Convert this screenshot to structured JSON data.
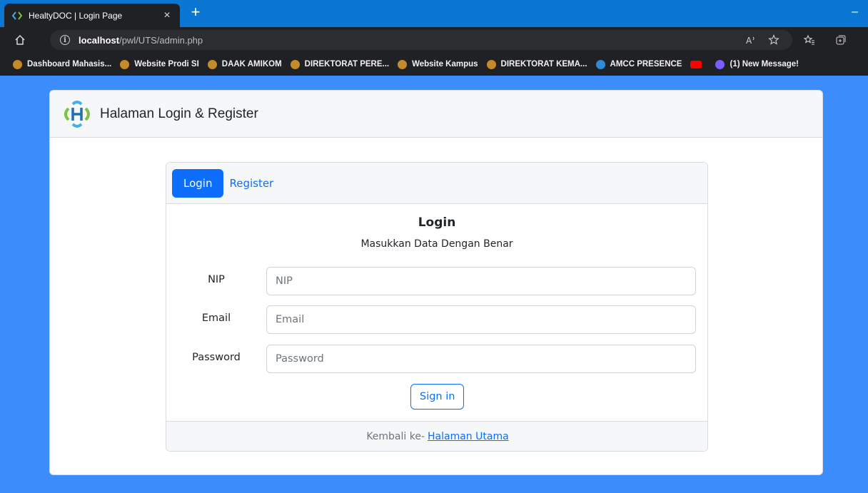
{
  "browser": {
    "tab_title": "HealtyDOC | Login Page",
    "tab_close": "×",
    "new_tab": "+",
    "minimize": "–",
    "url_host": "localhost",
    "url_path": "/pwl/UTS/admin.php"
  },
  "bookmarks": [
    {
      "label": "Dashboard Mahasis...",
      "icon_color": "#c58a2a"
    },
    {
      "label": "Website Prodi SI",
      "icon_color": "#c58a2a"
    },
    {
      "label": "DAAK AMIKOM",
      "icon_color": "#c58a2a"
    },
    {
      "label": "DIREKTORAT PERE...",
      "icon_color": "#c58a2a"
    },
    {
      "label": "Website Kampus",
      "icon_color": "#c58a2a"
    },
    {
      "label": "DIREKTORAT KEMA...",
      "icon_color": "#c58a2a"
    },
    {
      "label": "AMCC PRESENCE",
      "icon_color": "#2f8bd6"
    },
    {
      "label": "",
      "icon_color": "#ff0000"
    },
    {
      "label": "(1) New Message!",
      "icon_color": "#7a5cff"
    }
  ],
  "page": {
    "title": "Halaman Login & Register"
  },
  "tabs": {
    "login": "Login",
    "register": "Register"
  },
  "login": {
    "heading": "Login",
    "subtitle": "Masukkan Data Dengan Benar",
    "fields": [
      {
        "label": "NIP",
        "placeholder": "NIP"
      },
      {
        "label": "Email",
        "placeholder": "Email"
      },
      {
        "label": "Password",
        "placeholder": "Password"
      }
    ],
    "submit": "Sign in",
    "footer_text": "Kembali ke-",
    "footer_link": "Halaman Utama"
  },
  "colors": {
    "page_bg": "#3c8dfb",
    "primary": "#0d6efd"
  }
}
